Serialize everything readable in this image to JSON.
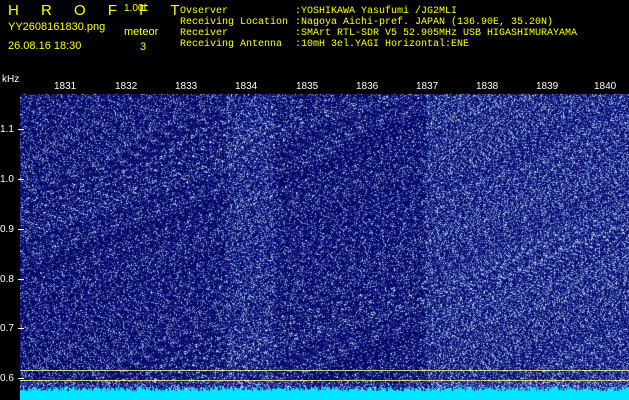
{
  "header": {
    "brand": "H R O F F T",
    "version": "1.00f",
    "filename": "YY2608161830.png",
    "datetime": "26.08.16 18:30",
    "meteor_label": "meteor",
    "meteor_count": "3"
  },
  "info": [
    {
      "key": "Ovserver",
      "value": ":YOSHIKAWA Yasufumi /JG2MLI"
    },
    {
      "key": "Receiving Location",
      "value": ":Nagoya Aichi-pref. JAPAN (136.90E, 35.20N)"
    },
    {
      "key": "Receiver",
      "value": ":SMArt RTL-SDR V5 52.905MHz USB HIGASHIMURAYAMA"
    },
    {
      "key": "Receiving Antenna",
      "value": ":10mH 3el.YAGI Horizontal:ENE"
    }
  ],
  "y_unit": "kHz",
  "y_ticks": [
    "1.1",
    "1.0",
    "0.9",
    "0.8",
    "0.7",
    "0.6"
  ],
  "x_ticks": [
    "1831",
    "1832",
    "1833",
    "1834",
    "1835",
    "1836",
    "1837",
    "1838",
    "1839",
    "1840"
  ],
  "colors": {
    "text": "#ffff00",
    "axis": "#ffffff",
    "noise_dark": "#0a0a70",
    "noise_bright": "#2040ff",
    "baseline": "#00e5ff"
  }
}
